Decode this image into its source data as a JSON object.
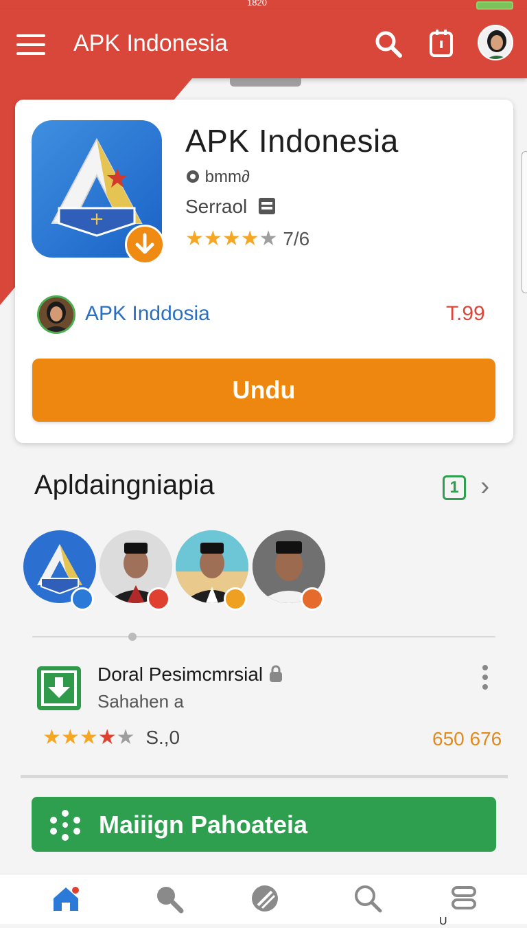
{
  "status_bar": {
    "left_text": "",
    "center_text": "1820"
  },
  "app_bar": {
    "title": "APK Indonesia"
  },
  "app_card": {
    "title": "APK Indonesia",
    "developer": "bmm∂",
    "category": "Serraol",
    "rating_text": "7/6",
    "publisher_name": "APK Inddosia",
    "price": "T.99",
    "download_label": "Undu"
  },
  "section": {
    "title": "Apldaingniapia",
    "badge": "1"
  },
  "list_item": {
    "title": "Doral Pesimcmrsial",
    "subtitle": "Sahahen a",
    "rating_text": "S.,0",
    "count": "650 676"
  },
  "promo": {
    "label": "Maiiign Pahoateia"
  },
  "bottom_nav": {
    "label_5": "U"
  },
  "colors": {
    "brand_red": "#d9473a",
    "accent_orange": "#ee8710",
    "accent_green": "#2e9e4f",
    "link_blue": "#2a6fc0"
  },
  "icons": {
    "menu": "hamburger-icon",
    "search": "search-icon",
    "calendar": "calendar-icon",
    "download_badge": "download-arrow-icon",
    "verified": "verified-icon",
    "home": "home-icon",
    "magnifier": "magnifier-icon",
    "compass": "compass-icon",
    "stack": "stack-icon"
  }
}
